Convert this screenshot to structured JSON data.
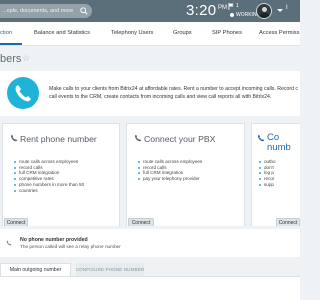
{
  "header": {
    "search_placeholder": "...ople, documents, and more",
    "clock_time": "3:20",
    "clock_ampm": "PM",
    "tasks_count": "1",
    "status": "WORKING",
    "account_label": "I"
  },
  "tabs": [
    {
      "label": "ction"
    },
    {
      "label": "Balance and Statistics"
    },
    {
      "label": "Telephony Users"
    },
    {
      "label": "Groups"
    },
    {
      "label": "SIP Phones"
    },
    {
      "label": "Access Permiss"
    }
  ],
  "page": {
    "title": "bers"
  },
  "intro": {
    "line1": "Make calls to your clients from Bitrix24 at affordable rates. Rent a number to accept incoming calls. Record c",
    "line2": "call events to the CRM, create contacts from incoming calls and view call reports all with Bitrix24."
  },
  "cards": [
    {
      "title": "Rent phone number",
      "features": [
        "route calls across employees",
        "record calls",
        "full CRM integration",
        "competitive rates",
        "phone numbers in more than 50",
        "countries"
      ],
      "button": "Connect"
    },
    {
      "title": "Connect your PBX",
      "features": [
        "route calls across employees",
        "record calls",
        "full CRM integration",
        "pay your telephony provider"
      ],
      "button": "Connect"
    },
    {
      "title": "Co numb",
      "features": [
        "outbo",
        "don't",
        "log p",
        "recor",
        "supp"
      ],
      "button": "Connect"
    }
  ],
  "no_number": {
    "title": "No phone number provided",
    "subtitle": "The person called will see a relay phone number"
  },
  "sub_tabs": {
    "active": "Main outgoing number",
    "inactive": "CONFIGURE PHONE NUMBER"
  },
  "colors": {
    "topbar": "#5b6f7a",
    "accent": "#2067b0",
    "phone_circle": "#1fb3d9"
  }
}
